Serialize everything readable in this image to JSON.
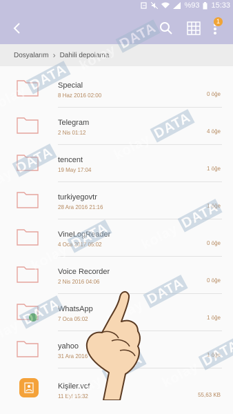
{
  "status_bar": {
    "battery": "%93",
    "time": "15:33"
  },
  "toolbar": {
    "notification_count": "1"
  },
  "breadcrumb": {
    "items": [
      "Dosyalarım",
      "Dahili depolama"
    ]
  },
  "files": [
    {
      "name": "Special",
      "date": "8 Haz 2016 02:00",
      "count": "0 öğe",
      "type": "folder"
    },
    {
      "name": "Telegram",
      "date": "2 Nis 01:12",
      "count": "4 öğe",
      "type": "folder"
    },
    {
      "name": "tencent",
      "date": "19 May 17:04",
      "count": "1 öğe",
      "type": "folder"
    },
    {
      "name": "turkiyegovtr",
      "date": "28 Ara 2016 21:16",
      "count": "1 öğe",
      "type": "folder"
    },
    {
      "name": "VineLogReader",
      "date": "4 Oca 2017 05:02",
      "count": "0 öğe",
      "type": "folder"
    },
    {
      "name": "Voice Recorder",
      "date": "2 Nis 2016 04:06",
      "count": "0 öğe",
      "type": "folder"
    },
    {
      "name": "WhatsApp",
      "date": "7 Oca 05:02",
      "count": "1 öğe",
      "type": "folder",
      "badge": "whatsapp"
    },
    {
      "name": "yahoo",
      "date": "31 Ara 2016",
      "count": "1 öğe",
      "type": "folder"
    },
    {
      "name": "Kişiler.vcf",
      "date": "11 Eyl 15:32",
      "count": "55,63 KB",
      "type": "file"
    }
  ],
  "watermark": {
    "brand": "kolay",
    "box": "DATA"
  },
  "colors": {
    "header": "#c3c1de",
    "folder_stroke": "#e5a39c",
    "meta_text": "#b68a60",
    "file_icon": "#f4a23a",
    "whatsapp": "#3c9c3c"
  }
}
